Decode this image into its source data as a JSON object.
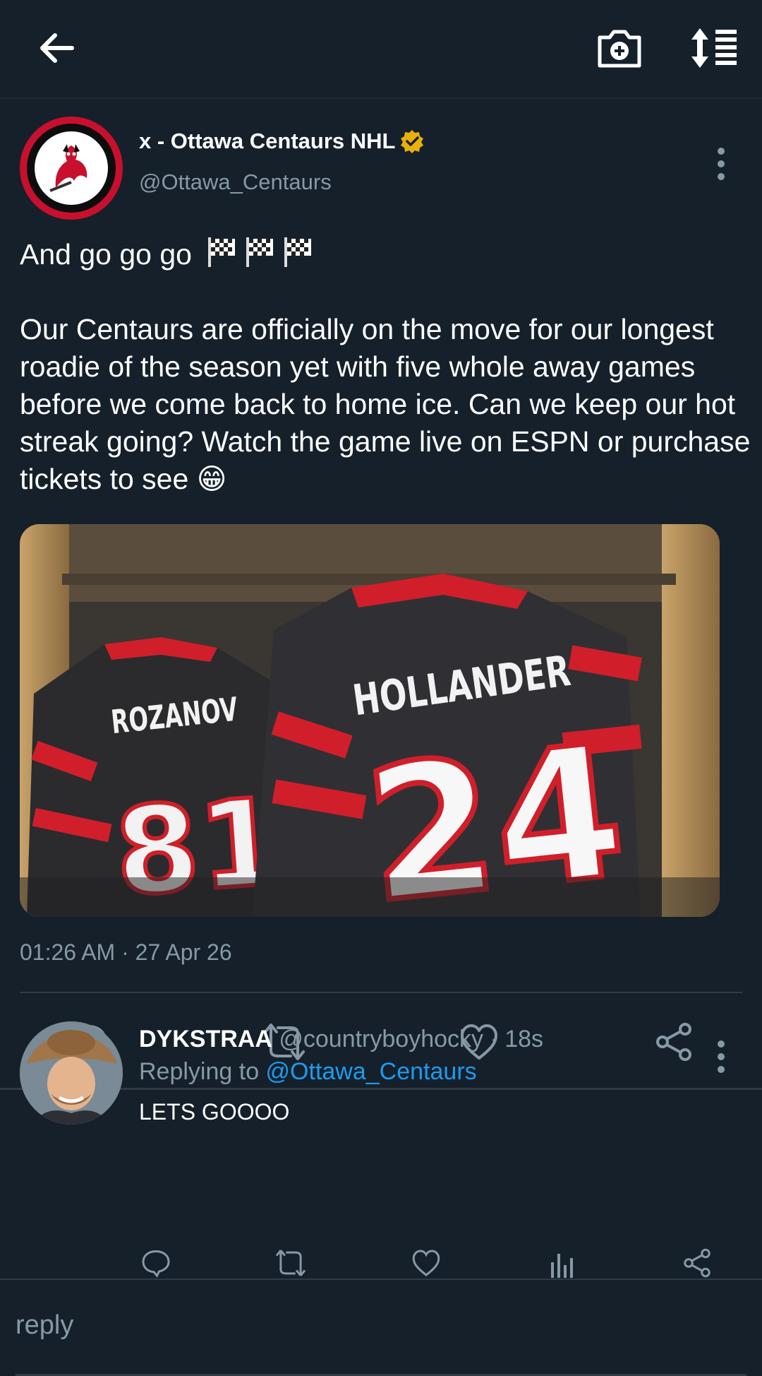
{
  "topbar": {
    "back_icon": "arrow-left-icon",
    "camera_icon": "camera-plus-icon",
    "sort_icon": "sort-list-icon"
  },
  "post": {
    "display_name": "x - Ottawa Centaurs NHL",
    "verified_icon": "verified-badge-icon",
    "verified_color": "#e8b10a",
    "handle": "@Ottawa_Centaurs",
    "text_line1": "And go go go",
    "text_body": "Our Centaurs are officially on the move for our longest roadie of the season yet with five whole away games before we come back to home ice. Can we keep our hot streak going? Watch the game live on ESPN or purchase tickets to see",
    "emoji": "😁",
    "timestamp": "01:26 AM · 27 Apr 26",
    "jersey_left_name": "ROZANOV",
    "jersey_left_number": "81",
    "jersey_right_name": "HOLLANDER",
    "jersey_right_number": "24"
  },
  "reply": {
    "name": "DYKSTRAA",
    "handle": "@countryboyhocky",
    "time": " · 18s",
    "replying_prefix": "Replying to ",
    "replying_to": "@Ottawa_Centaurs",
    "text": "LETS GOOOO"
  },
  "composer": {
    "placeholder": "reply"
  },
  "colors": {
    "background": "#15202b",
    "secondary_text": "#8899a6",
    "link": "#1d9bf0",
    "accent_red": "#c8102e"
  }
}
